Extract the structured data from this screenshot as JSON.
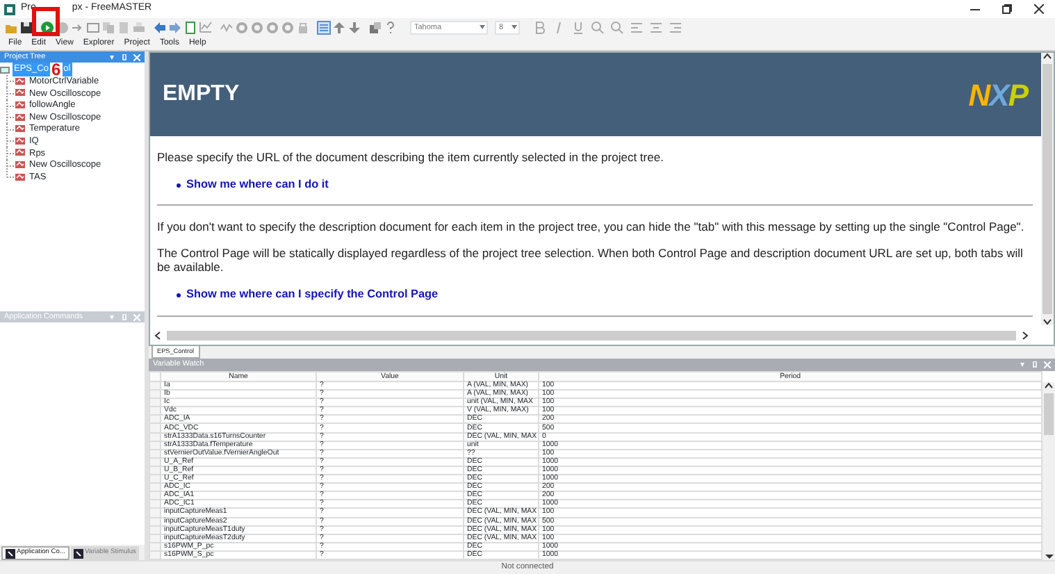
{
  "window": {
    "title_start": "Pro",
    "title_end": "px - FreeMASTER"
  },
  "annotation": {
    "label": "6"
  },
  "toolbar": {
    "font": "Tahoma",
    "size": "8"
  },
  "menu": [
    "File",
    "Edit",
    "View",
    "Explorer",
    "Project",
    "Tools",
    "Help"
  ],
  "project_tree": {
    "title": "Project Tree",
    "root": {
      "label_start": "EPS_Co",
      "label_end": "ol",
      "selected": true,
      "children": [
        {
          "label": "MotorCtrlVariable",
          "selected": false
        },
        {
          "label": "New Oscilloscope",
          "selected": false
        },
        {
          "label": "followAngle",
          "selected": false
        },
        {
          "label": "New Oscilloscope",
          "selected": false
        },
        {
          "label": "Temperature",
          "selected": false
        },
        {
          "label": "IQ",
          "selected": false
        },
        {
          "label": "Rps",
          "selected": false
        },
        {
          "label": "New Oscilloscope",
          "selected": false
        },
        {
          "label": "TAS",
          "selected": false
        }
      ]
    }
  },
  "app_commands": {
    "title": "Application Commands"
  },
  "left_tabs": [
    {
      "label": "Application Co...",
      "selected": true
    },
    {
      "label": "Variable Stimulus",
      "selected": false
    }
  ],
  "document": {
    "heading": "EMPTY",
    "logo": "NXP",
    "blocks": [
      {
        "kind": "text",
        "text": "Please specify the URL of the document describing the item currently selected in the project tree."
      },
      {
        "kind": "link",
        "text": "Show me where can I do it"
      },
      {
        "kind": "rule"
      },
      {
        "kind": "text",
        "text": "If you don't want to specify the description document for each item in the project tree, you can hide the \"tab\" with this message by setting up the single \"Control Page\"."
      },
      {
        "kind": "text",
        "text": "The Control Page will be statically displayed regardless of the project tree selection. When both Control Page and description document URL are set up, both tabs will be available."
      },
      {
        "kind": "link",
        "text": "Show me where can I specify the Control Page"
      },
      {
        "kind": "rule"
      }
    ]
  },
  "doc_tabs": [
    {
      "label": "EPS_Control",
      "selected": true
    }
  ],
  "variable_watch": {
    "title": "Variable Watch",
    "columns": [
      "Name",
      "Value",
      "Unit",
      "Period"
    ],
    "rows": [
      [
        "Ia",
        "?",
        "A (VAL, MIN, MAX)",
        "100"
      ],
      [
        "Ib",
        "?",
        "A (VAL, MIN, MAX)",
        "100"
      ],
      [
        "Ic",
        "?",
        "unit (VAL, MIN, MAX",
        "100"
      ],
      [
        "Vdc",
        "?",
        "V (VAL, MIN, MAX)",
        "100"
      ],
      [
        "ADC_IA",
        "?",
        "DEC",
        "200"
      ],
      [
        "ADC_VDC",
        "?",
        "DEC",
        "500"
      ],
      [
        "strA1333Data.s16TurnsCounter",
        "?",
        "DEC (VAL, MIN, MAX",
        "0"
      ],
      [
        "strA1333Data.fTemperature",
        "?",
        "unit",
        "1000"
      ],
      [
        "stVernierOutValue.fVernierAngleOut",
        "?",
        "??",
        "100"
      ],
      [
        "U_A_Ref",
        "?",
        "DEC",
        "1000"
      ],
      [
        "U_B_Ref",
        "?",
        "DEC",
        "1000"
      ],
      [
        "U_C_Ref",
        "?",
        "DEC",
        "1000"
      ],
      [
        "ADC_IC",
        "?",
        "DEC",
        "200"
      ],
      [
        "ADC_IA1",
        "?",
        "DEC",
        "200"
      ],
      [
        "ADC_IC1",
        "?",
        "DEC",
        "1000"
      ],
      [
        "inputCaptureMeas1",
        "?",
        "DEC (VAL, MIN, MAX",
        "100"
      ],
      [
        "inputCaptureMeas2",
        "?",
        "DEC (VAL, MIN, MAX",
        "500"
      ],
      [
        "inputCaptureMeasT1duty",
        "?",
        "DEC (VAL, MIN, MAX",
        "100"
      ],
      [
        "inputCaptureMeasT2duty",
        "?",
        "DEC (VAL, MIN, MAX",
        "100"
      ],
      [
        "s16PWM_P_pc",
        "?",
        "DEC",
        "1000"
      ],
      [
        "s16PWM_S_pc",
        "?",
        "DEC",
        "1000"
      ]
    ]
  },
  "status_bar": "Not connected"
}
